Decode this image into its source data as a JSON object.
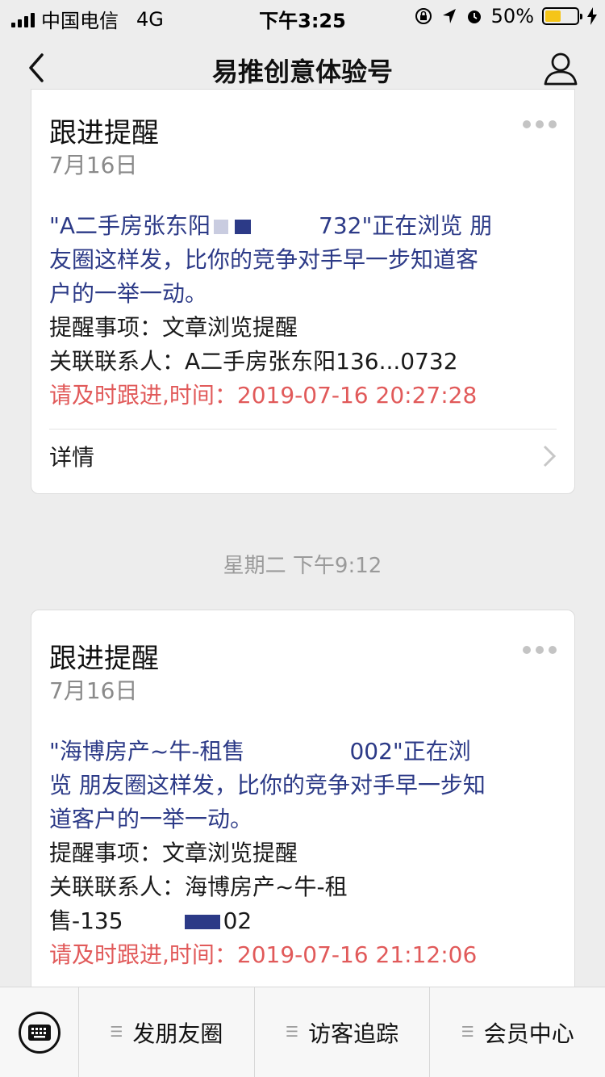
{
  "status_bar": {
    "carrier": "中国电信",
    "network": "4G",
    "time": "下午3:25",
    "battery": "50%",
    "battery_level": 0.5
  },
  "nav": {
    "title": "易推创意体验号"
  },
  "cards": [
    {
      "title": "跟进提醒",
      "date": "7月16日",
      "message_line1_a": "\"A二手房张东阳",
      "message_line1_b": "732\"正在浏览 朋",
      "message_line2": "友圈这样发，比你的竞争对手早一步知道客",
      "message_line3": "户的一举一动。",
      "item_line": "提醒事项：文章浏览提醒",
      "contact_line": "关联联系人：A二手房张东阳136...0732",
      "time_line": "请及时跟进,时间：2019-07-16 20:27:28",
      "detail_label": "详情"
    },
    {
      "title": "跟进提醒",
      "date": "7月16日",
      "message_line1_a": "\"海博房产~牛-租售",
      "message_line1_b": "002\"正在浏",
      "message_line2": "览 朋友圈这样发，比你的竞争对手早一步知",
      "message_line3": "道客户的一举一动。",
      "item_line": "提醒事项：文章浏览提醒",
      "contact_line1": "关联联系人：海博房产~牛-租",
      "contact_line2": "售-135",
      "contact_line2_tail": "02",
      "time_line": "请及时跟进,时间：2019-07-16 21:12:06"
    }
  ],
  "timestamp": "星期二 下午9:12",
  "bottom_menu": [
    {
      "label": "发朋友圈"
    },
    {
      "label": "访客追踪"
    },
    {
      "label": "会员中心"
    }
  ],
  "colors": {
    "accent_red": "#e15a5a",
    "message_blue": "#2c3a87",
    "battery_yellow": "#f5c518"
  }
}
